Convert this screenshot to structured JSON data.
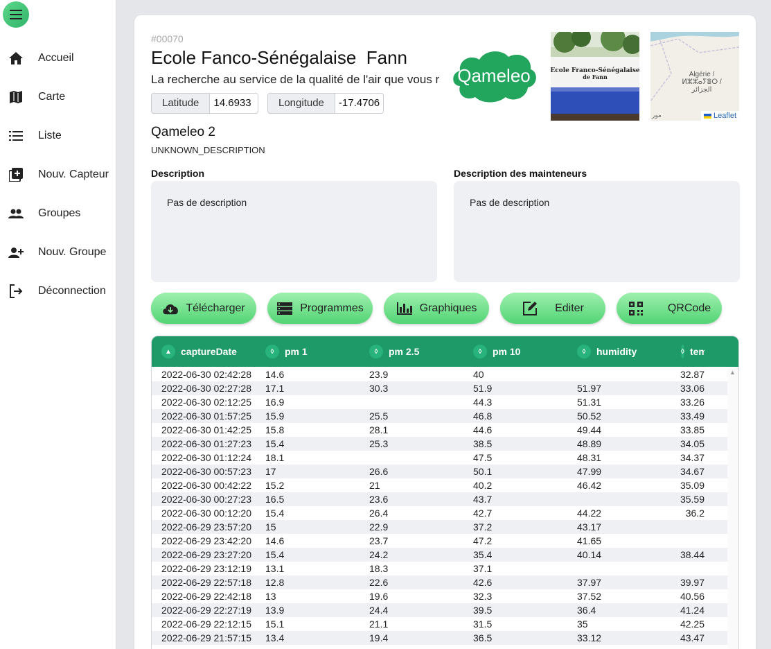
{
  "sidebar": {
    "items": [
      {
        "label": "Accueil",
        "icon": "home-icon"
      },
      {
        "label": "Carte",
        "icon": "map-icon"
      },
      {
        "label": "Liste",
        "icon": "list-icon"
      },
      {
        "label": "Nouv. Capteur",
        "icon": "add-box-icon"
      },
      {
        "label": "Groupes",
        "icon": "group-icon"
      },
      {
        "label": "Nouv. Groupe",
        "icon": "add-person-icon"
      },
      {
        "label": "Déconnection",
        "icon": "logout-icon"
      }
    ]
  },
  "header": {
    "sensor_id": "#00070",
    "title": "Ecole Fanco-Sénégalaise  Fann",
    "subtitle": "La recherche au service de la qualité de l'air que vous respirez",
    "latitude_label": "Latitude",
    "latitude_value": "14.6933",
    "longitude_label": "Longitude",
    "longitude_value": "-17.4706",
    "logo_text": "Qameleo",
    "photo_sign_line1": "Ecole Franco-Sénégalaise",
    "photo_sign_line2": "de Fann",
    "map_region_line1": "Algérie /",
    "map_region_line2": "ⵍⵣⵣⴰⵢⴻⵔ /",
    "map_region_line3": "الجزائر",
    "map_morocco": "مور",
    "map_attribution": "Leaflet"
  },
  "model": "Qameleo 2",
  "model_description": "UNKNOWN_DESCRIPTION",
  "description": {
    "label": "Description",
    "text": "Pas de description"
  },
  "maintainers_description": {
    "label": "Description des mainteneurs",
    "text": "Pas de description"
  },
  "actions": {
    "download": "Télécharger",
    "programs": "Programmes",
    "charts": "Graphiques",
    "edit": "Editer",
    "qrcode": "QRCode"
  },
  "colors": {
    "accent": "#1e9a68",
    "button_green": "#52d474"
  },
  "table": {
    "columns": [
      "captureDate",
      "pm 1",
      "pm 2.5",
      "pm 10",
      "humidity",
      "tem"
    ],
    "rows": [
      [
        "2022-06-30 02:42:28",
        "14.6",
        "23.9",
        "40",
        "",
        "32.87"
      ],
      [
        "2022-06-30 02:27:28",
        "17.1",
        "30.3",
        "51.9",
        "51.97",
        "33.06"
      ],
      [
        "2022-06-30 02:12:25",
        "16.9",
        "",
        "44.3",
        "51.31",
        "33.26"
      ],
      [
        "2022-06-30 01:57:25",
        "15.9",
        "25.5",
        "46.8",
        "50.52",
        "33.49"
      ],
      [
        "2022-06-30 01:42:25",
        "15.8",
        "28.1",
        "44.6",
        "49.44",
        "33.85"
      ],
      [
        "2022-06-30 01:27:23",
        "15.4",
        "25.3",
        "38.5",
        "48.89",
        "34.05"
      ],
      [
        "2022-06-30 01:12:24",
        "18.1",
        "",
        "47.5",
        "48.31",
        "34.37"
      ],
      [
        "2022-06-30 00:57:23",
        "17",
        "26.6",
        "50.1",
        "47.99",
        "34.67"
      ],
      [
        "2022-06-30 00:42:22",
        "15.2",
        "21",
        "40.2",
        "46.42",
        "35.09"
      ],
      [
        "2022-06-30 00:27:23",
        "16.5",
        "23.6",
        "43.7",
        "",
        "35.59"
      ],
      [
        "2022-06-30 00:12:20",
        "15.4",
        "26.4",
        "42.7",
        "44.22",
        "36.2"
      ],
      [
        "2022-06-29 23:57:20",
        "15",
        "22.9",
        "37.2",
        "43.17",
        ""
      ],
      [
        "2022-06-29 23:42:20",
        "14.6",
        "23.7",
        "47.2",
        "41.65",
        ""
      ],
      [
        "2022-06-29 23:27:20",
        "15.4",
        "24.2",
        "35.4",
        "40.14",
        "38.44"
      ],
      [
        "2022-06-29 23:12:19",
        "13.1",
        "18.3",
        "37.1",
        "",
        ""
      ],
      [
        "2022-06-29 22:57:18",
        "12.8",
        "22.6",
        "42.6",
        "37.97",
        "39.97"
      ],
      [
        "2022-06-29 22:42:18",
        "13",
        "19.6",
        "32.3",
        "37.52",
        "40.56"
      ],
      [
        "2022-06-29 22:27:19",
        "13.9",
        "24.4",
        "39.5",
        "36.4",
        "41.24"
      ],
      [
        "2022-06-29 22:12:15",
        "15.1",
        "21.1",
        "31.5",
        "35",
        "42.25"
      ],
      [
        "2022-06-29 21:57:15",
        "13.4",
        "19.4",
        "36.5",
        "33.12",
        "43.47"
      ]
    ]
  }
}
